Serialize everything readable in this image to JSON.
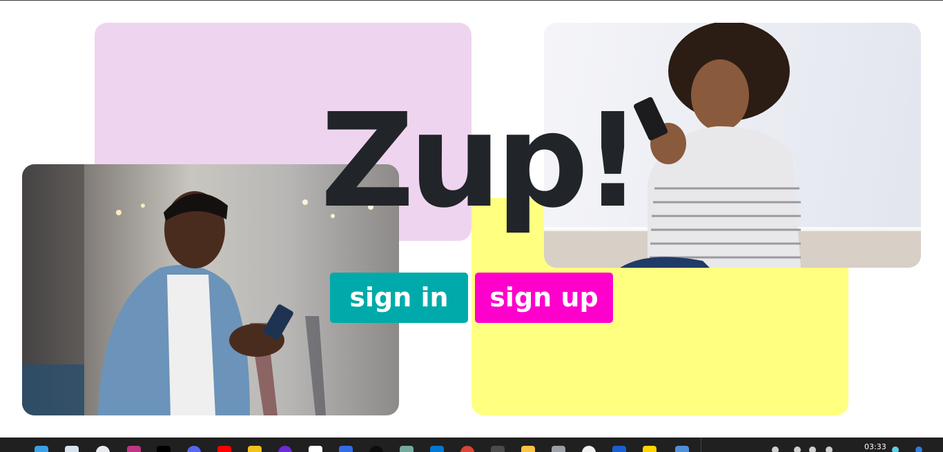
{
  "hero": {
    "title": "Zup!"
  },
  "actions": {
    "sign_in_label": "sign in",
    "sign_up_label": "sign up"
  },
  "colors": {
    "pink_tile": "#efd4ef",
    "yellow_tile": "#ffff80",
    "sign_in": "#00aaaa",
    "sign_up": "#ff00cc",
    "title_text": "#212529"
  },
  "images": {
    "left_photo": "man-with-phone-photo",
    "right_photo": "woman-with-phone-photo"
  },
  "taskbar": {
    "clock": "03:33",
    "apps": [
      "windows-start-icon",
      "store-icon",
      "chrome-icon",
      "instagram-icon",
      "x-icon",
      "discord-icon",
      "youtube-icon",
      "sticky-notes-icon",
      "podcast-icon",
      "notion-icon",
      "kubernetes-icon",
      "github-icon",
      "chatgpt-icon",
      "vscode-icon",
      "chrome-active-icon",
      "terminal-icon",
      "file-explorer-icon",
      "database-icon",
      "github-desktop-icon",
      "password-icon",
      "notes-icon",
      "calculator-icon"
    ]
  }
}
